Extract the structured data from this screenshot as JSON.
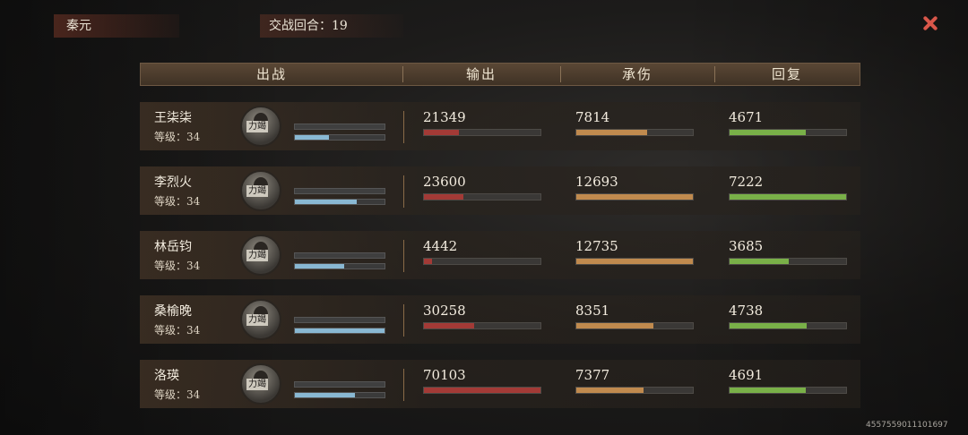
{
  "top": {
    "location": "秦元",
    "round": "交战回合：19"
  },
  "header": {
    "col1": "出战",
    "col2": "输出",
    "col3": "承伤",
    "col4": "回复"
  },
  "rows": [
    {
      "name": "王柒柒",
      "level": "等级：34",
      "tag": "力竭",
      "mini1": 1.0,
      "mini2": 0.38,
      "output": "21349",
      "output_ratio": 0.3,
      "damage": "7814",
      "damage_ratio": 0.61,
      "heal": "4671",
      "heal_ratio": 0.65
    },
    {
      "name": "李烈火",
      "level": "等级：34",
      "tag": "力竭",
      "mini1": 1.0,
      "mini2": 0.69,
      "output": "23600",
      "output_ratio": 0.34,
      "damage": "12693",
      "damage_ratio": 1.0,
      "heal": "7222",
      "heal_ratio": 1.0
    },
    {
      "name": "林岳钧",
      "level": "等级：34",
      "tag": "力竭",
      "mini1": 1.0,
      "mini2": 0.55,
      "output": "4442",
      "output_ratio": 0.07,
      "damage": "12735",
      "damage_ratio": 1.0,
      "heal": "3685",
      "heal_ratio": 0.51
    },
    {
      "name": "桑榆晚",
      "level": "等级：34",
      "tag": "力竭",
      "mini1": 1.0,
      "mini2": 1.0,
      "output": "30258",
      "output_ratio": 0.43,
      "damage": "8351",
      "damage_ratio": 0.66,
      "heal": "4738",
      "heal_ratio": 0.66
    },
    {
      "name": "洛瑛",
      "level": "等级：34",
      "tag": "力竭",
      "mini1": 1.0,
      "mini2": 0.67,
      "output": "70103",
      "output_ratio": 1.0,
      "damage": "7377",
      "damage_ratio": 0.58,
      "heal": "4691",
      "heal_ratio": 0.65
    }
  ],
  "watermark": "4557559011101697",
  "colors": {
    "output": "#a33a36",
    "damage": "#c08a4e",
    "heal": "#79b048",
    "mini": "#89b8d3",
    "close": "#d9574a"
  }
}
